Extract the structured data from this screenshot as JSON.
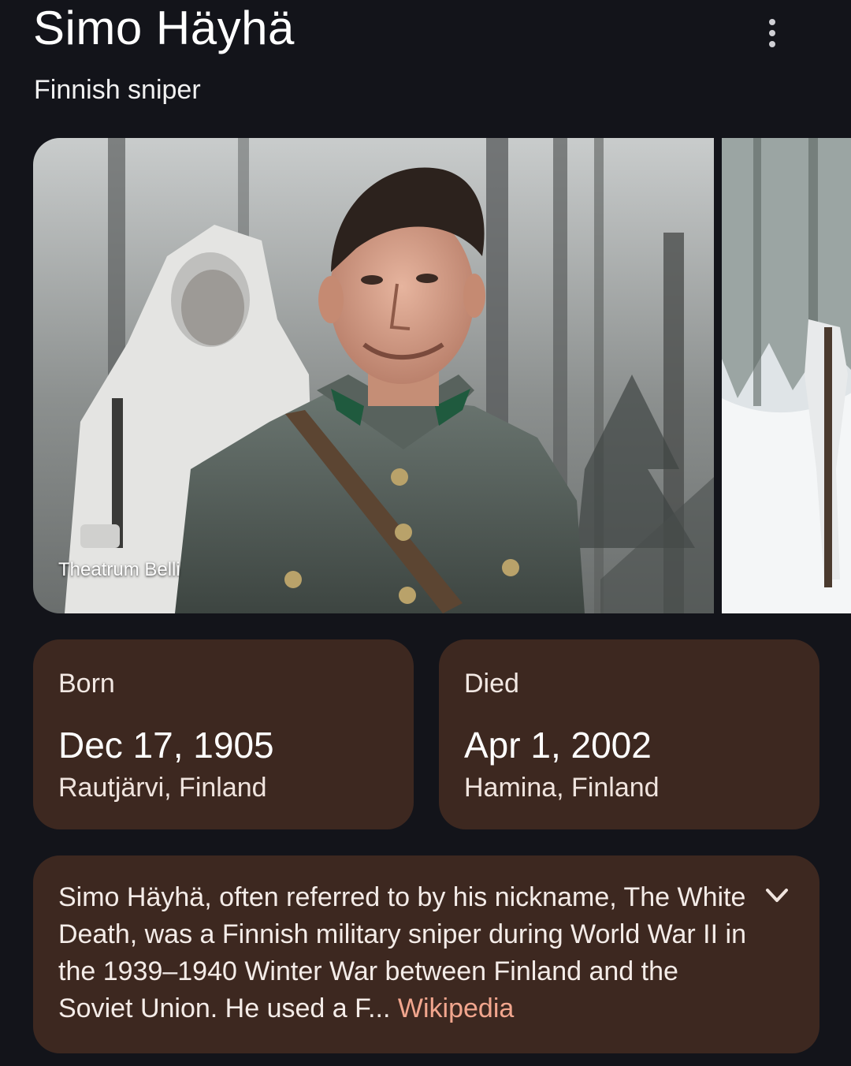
{
  "header": {
    "title": "Simo Häyhä",
    "subtitle": "Finnish sniper",
    "more_icon": "more-vert-icon"
  },
  "images": {
    "main_credit": "Theatrum Belli"
  },
  "born": {
    "label": "Born",
    "date": "Dec 17, 1905",
    "place": "Rautjärvi, Finland"
  },
  "died": {
    "label": "Died",
    "date": "Apr 1, 2002",
    "place": "Hamina, Finland"
  },
  "description": {
    "text": "Simo Häyhä, often referred to by his nickname, The White Death, was a Finnish military sniper during World War II in the 1939–1940 Winter War between Finland and the Soviet Union. He used a F...",
    "source": "Wikipedia",
    "expand_icon": "chevron-down-icon"
  },
  "colors": {
    "background": "#13141a",
    "card": "#3d2820",
    "link": "#f2a68e"
  }
}
